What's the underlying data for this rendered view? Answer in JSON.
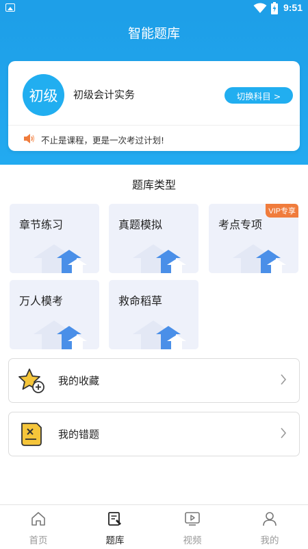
{
  "status_bar": {
    "time": "9:51"
  },
  "header": {
    "title": "智能题库"
  },
  "course_card": {
    "level_badge": "初级",
    "course_name": "初级会计实务",
    "switch_button": "切换科目 >",
    "slogan": "不止是课程，更是一次考过计划!"
  },
  "question_bank": {
    "section_title": "题库类型",
    "tiles": [
      {
        "label": "章节练习"
      },
      {
        "label": "真题模拟"
      },
      {
        "label": "考点专项",
        "tag": "VIP专享"
      },
      {
        "label": "万人模考"
      },
      {
        "label": "救命稻草"
      }
    ]
  },
  "list": {
    "favorites": "我的收藏",
    "mistakes": "我的错题"
  },
  "tabbar": {
    "tabs": [
      {
        "label": "首页",
        "icon": "home-icon"
      },
      {
        "label": "题库",
        "icon": "question-bank-icon",
        "active": true
      },
      {
        "label": "视频",
        "icon": "video-icon"
      },
      {
        "label": "我的",
        "icon": "profile-icon"
      }
    ]
  },
  "colors": {
    "primary": "#21aef0",
    "vip": "#f07c3c",
    "tile_bg": "#eef1fa"
  }
}
